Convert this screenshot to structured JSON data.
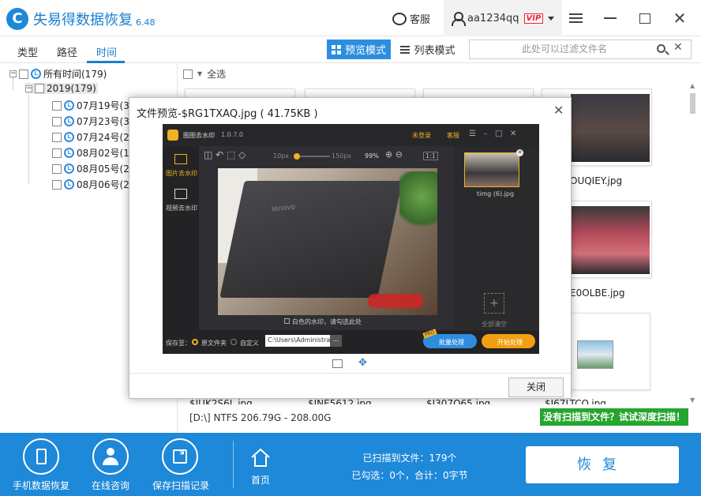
{
  "app": {
    "title": "失易得数据恢复",
    "version": "6.48",
    "service_label": "客服",
    "username": "aa1234qq",
    "vip_badge": "VIP"
  },
  "tabs": [
    {
      "label": "类型"
    },
    {
      "label": "路径"
    },
    {
      "label": "时间"
    }
  ],
  "view_modes": {
    "preview_label": "预览模式",
    "list_label": "列表模式"
  },
  "filter": {
    "placeholder": "此处可以过滤文件名"
  },
  "tree": {
    "root_label": "所有时间(179)",
    "year_label": "2019(179)",
    "days": [
      "07月19号(3",
      "07月23号(3",
      "07月24号(2",
      "08月02号(1",
      "08月05号(2",
      "08月06号(2"
    ]
  },
  "select_all_label": "全选",
  "files": {
    "right_col": [
      "OUQIEY.jpg",
      "E0OLBE.jpg"
    ],
    "bottom_row": [
      "$IUK2S6L.jpg",
      "$INE5612.jpg",
      "$I307Q65.jpg",
      "$I67LTCO.jpg"
    ]
  },
  "preview_dialog": {
    "title": "文件预览-$RG1TXAQ.jpg ( 41.75KB )",
    "close_button_label": "关闭",
    "inner_app": {
      "title": "图图去水印",
      "version": "1.0.7.0",
      "login": "未登录",
      "service": "客服",
      "side_image": "图片去水印",
      "side_video": "视频去水印",
      "size_min": "10px",
      "size_max": "150px",
      "zoom": "99%",
      "ratio": "1:1",
      "thumb_name": "timg (6).jpg",
      "clear_all": "全部清空",
      "laptop_brand": "lenovo",
      "white_wm_label": "白色的水印，请勾选此处",
      "save_to": "保存至：",
      "source_folder": "原文件夹",
      "custom": "自定义",
      "path": "C:\\Users\\Administrator",
      "path_btn": "...",
      "batch_btn": "批量处理",
      "start_btn": "开始处理",
      "pro_tag": "PRO"
    }
  },
  "status": {
    "drive_info": "[D:\\] NTFS 206.79G - 208.00G",
    "deep_scan": "没有扫描到文件？试试深度扫描！",
    "scanned": "已扫描到文件：179个",
    "selected": "已勾选：0个，合计：0字节"
  },
  "bottom_nav": {
    "phone": "手机数据恢复",
    "consult": "在线咨询",
    "save": "保存扫描记录",
    "home": "首页",
    "recover": "恢复"
  },
  "colors": {
    "primary": "#1e88d9",
    "deep_scan": "#26a52e",
    "vip": "#e22233"
  }
}
